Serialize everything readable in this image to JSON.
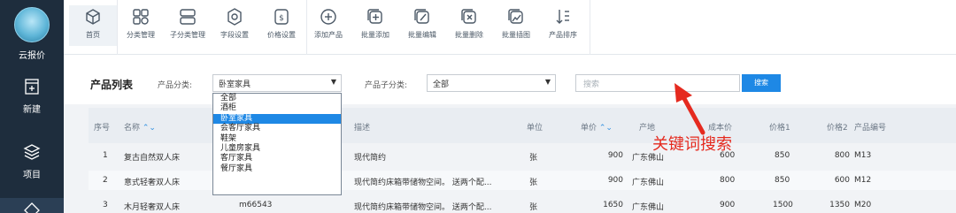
{
  "rail": {
    "logo_label": "云报价",
    "items": [
      {
        "label": "新建",
        "icon": "add-document-icon"
      },
      {
        "label": "项目",
        "icon": "layers-icon"
      }
    ]
  },
  "toolbar": {
    "items": [
      {
        "label": "首页",
        "icon": "cube-icon"
      },
      {
        "label": "分类管理",
        "icon": "category-grid-icon"
      },
      {
        "label": "子分类管理",
        "icon": "subcategory-icon"
      },
      {
        "label": "字段设置",
        "icon": "field-settings-icon"
      },
      {
        "label": "价格设置",
        "icon": "price-settings-icon"
      },
      {
        "label": "添加产品",
        "icon": "add-circle-icon"
      },
      {
        "label": "批量添加",
        "icon": "batch-add-icon"
      },
      {
        "label": "批量编辑",
        "icon": "batch-edit-icon"
      },
      {
        "label": "批量删除",
        "icon": "batch-delete-icon"
      },
      {
        "label": "批量插图",
        "icon": "batch-image-icon"
      },
      {
        "label": "产品排序",
        "icon": "sort-icon"
      }
    ]
  },
  "filters": {
    "page_title": "产品列表",
    "category_label": "产品分类:",
    "category_value": "卧室家具",
    "subcategory_label": "产品子分类:",
    "subcategory_value": "全部",
    "search_placeholder": "搜索",
    "search_button": "搜索"
  },
  "category_options": [
    "全部",
    "酒柜",
    "卧室家具",
    "会客厅家具",
    "鞋架",
    "儿童房家具",
    "客厅家具",
    "餐厅家具"
  ],
  "table": {
    "headers": {
      "index": "序号",
      "name": "名称",
      "desc": "描述",
      "unit": "单位",
      "price": "单价",
      "origin": "产地",
      "cost": "成本价",
      "price1": "价格1",
      "price2": "价格2",
      "code": "产品编号"
    },
    "rows": [
      {
        "index": "1",
        "name": "复古自然双人床",
        "model": "",
        "desc": "现代简约",
        "unit": "张",
        "price": "900",
        "origin": "广东佛山",
        "cost": "600",
        "price1": "850",
        "price2": "800",
        "code": "M13"
      },
      {
        "index": "2",
        "name": "意式轻奢双人床",
        "model": "",
        "desc": "现代简约床箱带储物空间。 送两个配...",
        "unit": "张",
        "price": "900",
        "origin": "广东佛山",
        "cost": "800",
        "price1": "850",
        "price2": "600",
        "code": "M12"
      },
      {
        "index": "3",
        "name": "木月轻奢双人床",
        "model": "m66543",
        "desc": "现代简约床箱带储物空间。 送两个配...",
        "unit": "张",
        "price": "1650",
        "origin": "广东佛山",
        "cost": "900",
        "price1": "1500",
        "price2": "1350",
        "code": "M20"
      }
    ]
  },
  "annotation": "关键词搜索",
  "colors": {
    "rail_bg": "#1e2d3d",
    "accent": "#1e88e5",
    "annotation": "#e52a1f"
  }
}
